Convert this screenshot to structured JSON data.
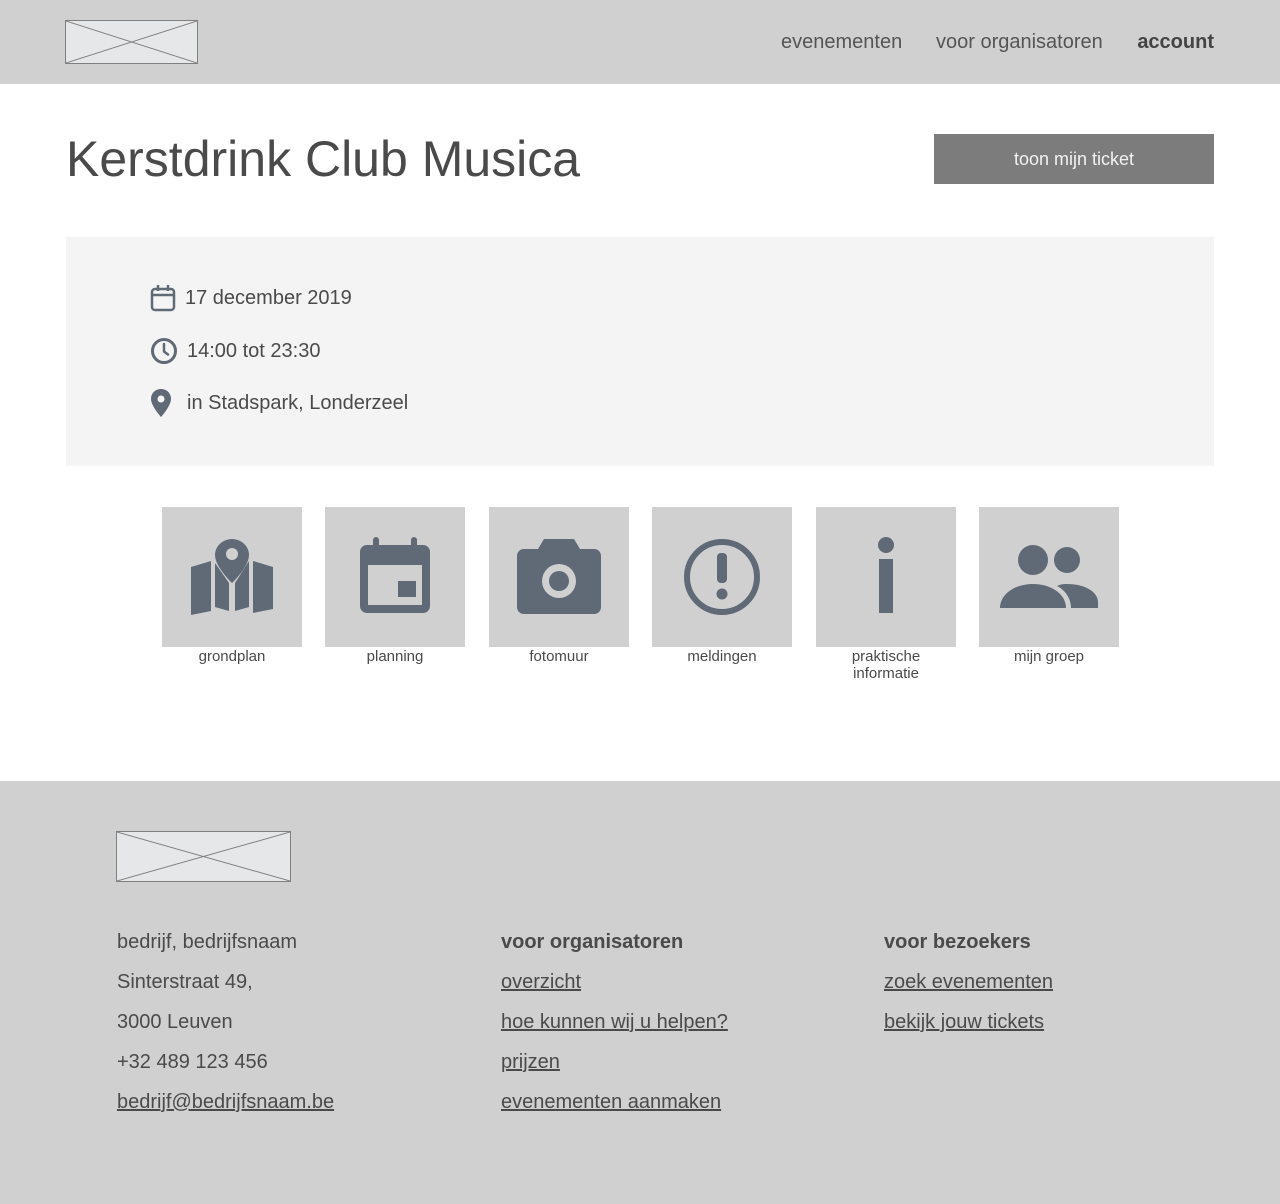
{
  "header": {
    "nav": {
      "events": "evenementen",
      "organizers": "voor organisatoren",
      "account": "account"
    }
  },
  "event": {
    "title": "Kerstdrink Club Musica",
    "ticket_button": "toon mijn ticket",
    "date": "17 december 2019",
    "time": "14:00 tot 23:30",
    "location": "in Stadspark, Londerzeel"
  },
  "tiles": [
    {
      "label": "grondplan",
      "icon": "map-icon"
    },
    {
      "label": "planning",
      "icon": "calendar-icon"
    },
    {
      "label": "fotomuur",
      "icon": "camera-icon"
    },
    {
      "label": "meldingen",
      "icon": "alert-icon"
    },
    {
      "label": "praktische informatie",
      "icon": "info-icon"
    },
    {
      "label": "mijn groep",
      "icon": "group-icon"
    }
  ],
  "footer": {
    "company": {
      "name": "bedrijf, bedrijfsnaam",
      "street": "Sinterstraat 49,",
      "city": "3000 Leuven",
      "phone": "+32 489 123 456",
      "email": "bedrijf@bedrijfsnaam.be"
    },
    "organizers": {
      "heading": "voor organisatoren",
      "links": [
        "overzicht",
        "hoe kunnen wij u helpen?",
        "prijzen",
        "evenementen aanmaken"
      ]
    },
    "visitors": {
      "heading": "voor bezoekers",
      "links": [
        "zoek evenementen",
        "bekijk jouw tickets"
      ]
    }
  },
  "colors": {
    "icon": "#5f6a76",
    "header_bg": "#d0d0d0",
    "button_bg": "#7c7c7c",
    "panel_bg": "#f4f4f4"
  }
}
